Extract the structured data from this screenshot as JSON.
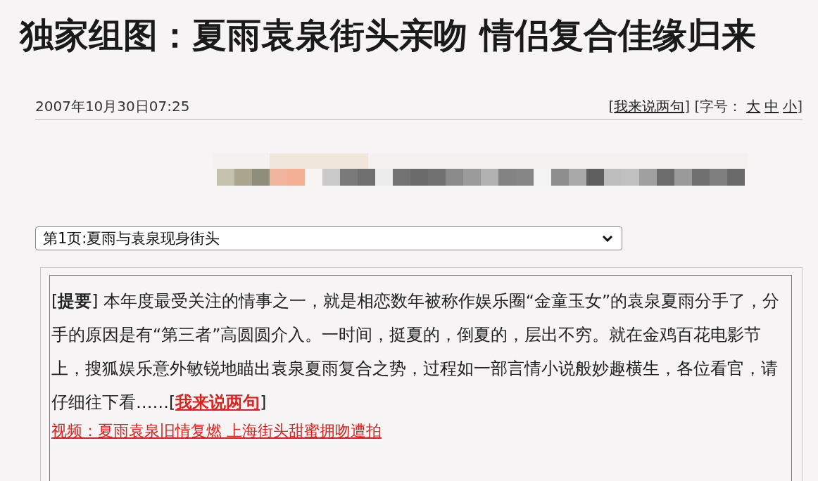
{
  "headline": "独家组图：夏雨袁泉街头亲吻 情侣复合佳缘归来",
  "dateline": "2007年10月30日07:25",
  "toolbar": {
    "open": "[",
    "comment_link": "我来说两句",
    "middle": "] [字号：",
    "sizes": [
      "大",
      "中",
      "小"
    ],
    "close": "]"
  },
  "page_select": {
    "value": "第1页:夏雨与袁泉现身街头"
  },
  "summary": {
    "text": "[**提要**] 本年度最受关注的情事之一，就是相恋数年被称作娱乐圈“金童玉女”的袁泉夏雨分手了，分手的原因是有“第三者”高圆圆介入。一时间，挺夏的，倒夏的，层出不穷。就在金鸡百花电影节上，搜狐娱乐意外敏锐地瞄出袁泉夏雨复合之势，过程如一部言情小说般妙趣横生，各位看官，请仔细往下看……[",
    "link": "我来说两句",
    "suffix": "]"
  },
  "video_link": "视频：夏雨袁泉旧情复燃 上海街头甜蜜拥吻遭拍"
}
